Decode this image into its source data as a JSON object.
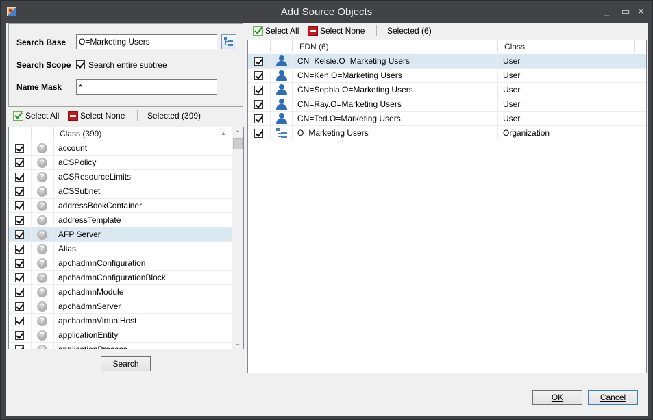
{
  "window": {
    "title": "Add Source Objects",
    "controls": {
      "minimize": "_",
      "maximize": "▭",
      "close": "✕"
    }
  },
  "search": {
    "base_label": "Search Base",
    "base_value": "O=Marketing Users",
    "scope_label": "Search Scope",
    "scope_option": "Search entire subtree",
    "scope_checked": true,
    "mask_label": "Name Mask",
    "mask_value": "*"
  },
  "left_toolbar": {
    "select_all": "Select All",
    "select_none": "Select None",
    "selected": "Selected (399)"
  },
  "class_list": {
    "header": "Class  (399)",
    "sort_indicator": "▲",
    "rows": [
      "account",
      "aCSPolicy",
      "aCSResourceLimits",
      "aCSSubnet",
      "addressBookContainer",
      "addressTemplate",
      "AFP Server",
      "Alias",
      "apchadmnConfiguration",
      "apchadmnConfigurationBlock",
      "apchadmnModule",
      "apchadmnServer",
      "apchadmnVirtualHost",
      "applicationEntity",
      "applicationProcess"
    ],
    "selected_row": "AFP Server"
  },
  "search_button": "Search",
  "right_toolbar": {
    "select_all": "Select All",
    "select_none": "Select None",
    "selected": "Selected (6)"
  },
  "results": {
    "columns": {
      "fdn": "FDN  (6)",
      "class": "Class"
    },
    "rows": [
      {
        "fdn": "CN=Kelsie.O=Marketing Users",
        "class": "User",
        "icon": "user-icon"
      },
      {
        "fdn": "CN=Ken.O=Marketing Users",
        "class": "User",
        "icon": "user-icon"
      },
      {
        "fdn": "CN=Sophia.O=Marketing Users",
        "class": "User",
        "icon": "user-icon"
      },
      {
        "fdn": "CN=Ray.O=Marketing Users",
        "class": "User",
        "icon": "user-icon"
      },
      {
        "fdn": "CN=Ted.O=Marketing Users",
        "class": "User",
        "icon": "user-icon"
      },
      {
        "fdn": "O=Marketing Users",
        "class": "Organization",
        "icon": "organization-icon"
      }
    ],
    "selected_row": "CN=Kelsie.O=Marketing Users"
  },
  "footer": {
    "ok": "OK",
    "cancel": "Cancel"
  }
}
